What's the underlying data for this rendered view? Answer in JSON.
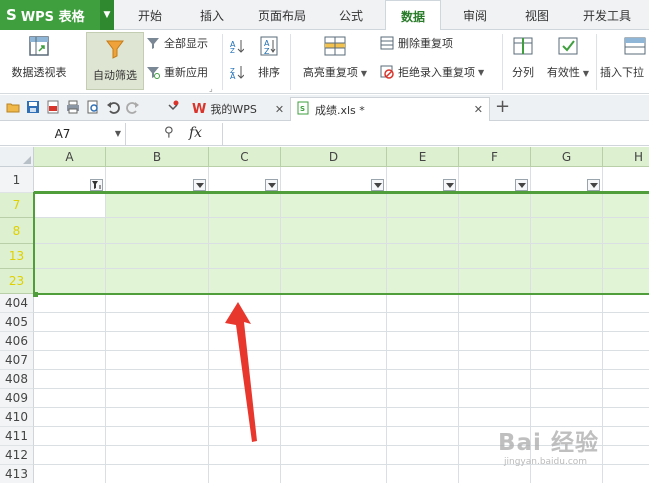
{
  "app": {
    "title": "WPS 表格"
  },
  "tabs": [
    {
      "label": "开始"
    },
    {
      "label": "插入"
    },
    {
      "label": "页面布局"
    },
    {
      "label": "公式"
    },
    {
      "label": "数据",
      "active": true
    },
    {
      "label": "审阅"
    },
    {
      "label": "视图"
    },
    {
      "label": "开发工具"
    }
  ],
  "ribbon": {
    "pivot": "数据透视表",
    "autofilter": "自动筛选",
    "show_all": "全部显示",
    "reapply": "重新应用",
    "sort": "排序",
    "highlight_dup": "高亮重复项",
    "remove_dup": "删除重复项",
    "reject_dup": "拒绝录入重复项",
    "split": "分列",
    "validity": "有效性",
    "insert_dropdown": "插入下拉"
  },
  "docs": [
    {
      "label": "我的WPS"
    },
    {
      "label": "成绩.xls *"
    }
  ],
  "formula_bar": {
    "name_box": "A7",
    "fx": "fx"
  },
  "columns": [
    "A",
    "B",
    "C",
    "D",
    "E",
    "F",
    "G",
    "H"
  ],
  "rows": [
    "1",
    "7",
    "8",
    "13",
    "23",
    "404",
    "405",
    "406",
    "407",
    "408",
    "409",
    "410",
    "411",
    "412",
    "413"
  ],
  "watermark": {
    "brand": "Bai 经验",
    "url": "jingyan.baidu.com"
  },
  "colors": {
    "accent": "#3f9f3f",
    "selection": "#e2f4d6",
    "arrow": "#e8382e"
  }
}
